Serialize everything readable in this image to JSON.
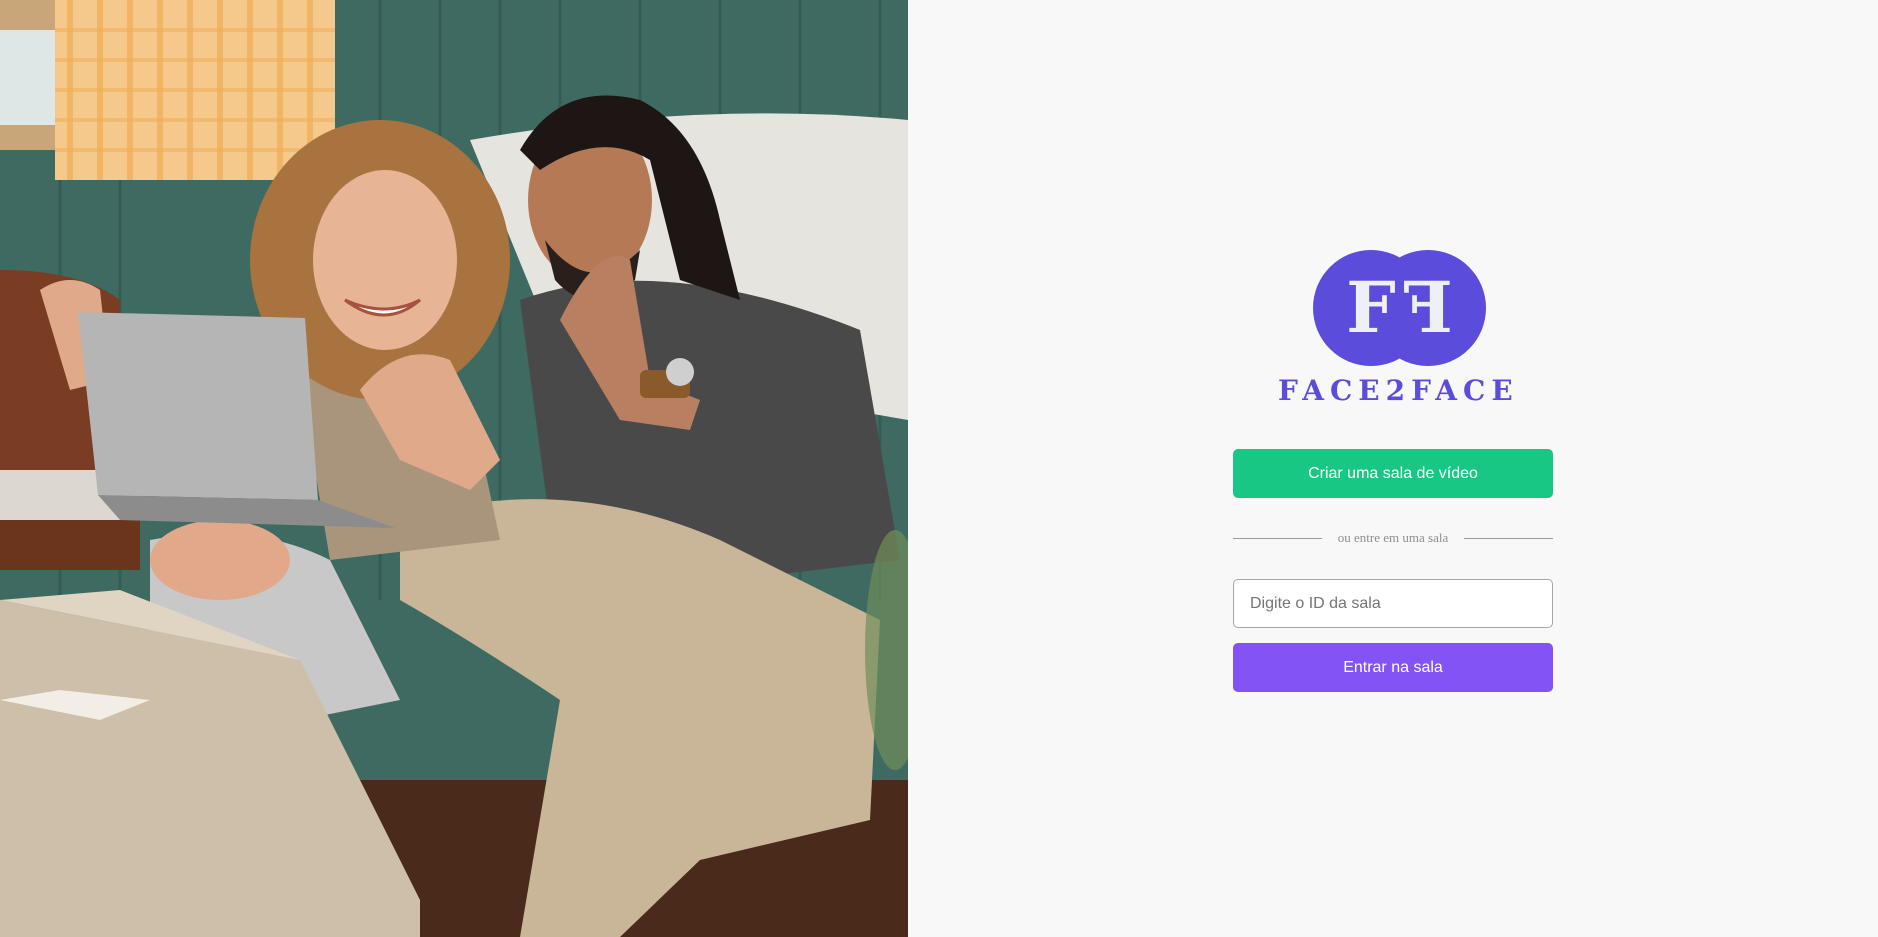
{
  "hero": {
    "image_alt": "Casal sorrindo acenando para uma chamada de vídeo em um notebook"
  },
  "logo": {
    "monogram_left": "F",
    "monogram_right": "F",
    "wordmark": "FACE2FACE",
    "brand_color": "#5b4cdb"
  },
  "actions": {
    "create_label": "Criar uma sala de vídeo",
    "divider_text": "ou entre em uma sala",
    "room_input_placeholder": "Digite o ID da sala",
    "room_input_value": "",
    "enter_label": "Entrar na sala"
  },
  "colors": {
    "create_button": "#19c785",
    "enter_button": "#8353f5",
    "panel_background": "#f8f8f8"
  }
}
